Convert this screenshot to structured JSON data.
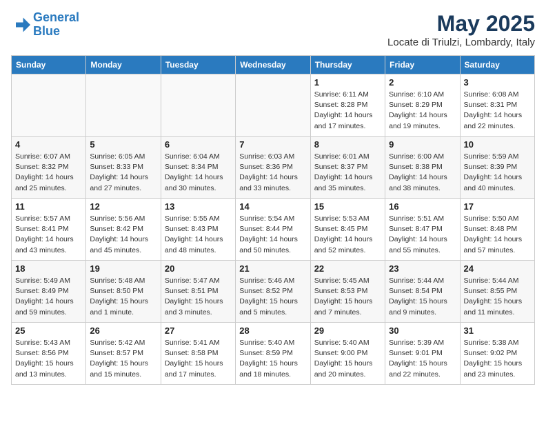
{
  "header": {
    "logo_line1": "General",
    "logo_line2": "Blue",
    "month_year": "May 2025",
    "location": "Locate di Triulzi, Lombardy, Italy"
  },
  "days_of_week": [
    "Sunday",
    "Monday",
    "Tuesday",
    "Wednesday",
    "Thursday",
    "Friday",
    "Saturday"
  ],
  "weeks": [
    [
      {
        "day": "",
        "info": "",
        "empty": true
      },
      {
        "day": "",
        "info": "",
        "empty": true
      },
      {
        "day": "",
        "info": "",
        "empty": true
      },
      {
        "day": "",
        "info": "",
        "empty": true
      },
      {
        "day": "1",
        "info": "Sunrise: 6:11 AM\nSunset: 8:28 PM\nDaylight: 14 hours\nand 17 minutes."
      },
      {
        "day": "2",
        "info": "Sunrise: 6:10 AM\nSunset: 8:29 PM\nDaylight: 14 hours\nand 19 minutes."
      },
      {
        "day": "3",
        "info": "Sunrise: 6:08 AM\nSunset: 8:31 PM\nDaylight: 14 hours\nand 22 minutes."
      }
    ],
    [
      {
        "day": "4",
        "info": "Sunrise: 6:07 AM\nSunset: 8:32 PM\nDaylight: 14 hours\nand 25 minutes."
      },
      {
        "day": "5",
        "info": "Sunrise: 6:05 AM\nSunset: 8:33 PM\nDaylight: 14 hours\nand 27 minutes."
      },
      {
        "day": "6",
        "info": "Sunrise: 6:04 AM\nSunset: 8:34 PM\nDaylight: 14 hours\nand 30 minutes."
      },
      {
        "day": "7",
        "info": "Sunrise: 6:03 AM\nSunset: 8:36 PM\nDaylight: 14 hours\nand 33 minutes."
      },
      {
        "day": "8",
        "info": "Sunrise: 6:01 AM\nSunset: 8:37 PM\nDaylight: 14 hours\nand 35 minutes."
      },
      {
        "day": "9",
        "info": "Sunrise: 6:00 AM\nSunset: 8:38 PM\nDaylight: 14 hours\nand 38 minutes."
      },
      {
        "day": "10",
        "info": "Sunrise: 5:59 AM\nSunset: 8:39 PM\nDaylight: 14 hours\nand 40 minutes."
      }
    ],
    [
      {
        "day": "11",
        "info": "Sunrise: 5:57 AM\nSunset: 8:41 PM\nDaylight: 14 hours\nand 43 minutes."
      },
      {
        "day": "12",
        "info": "Sunrise: 5:56 AM\nSunset: 8:42 PM\nDaylight: 14 hours\nand 45 minutes."
      },
      {
        "day": "13",
        "info": "Sunrise: 5:55 AM\nSunset: 8:43 PM\nDaylight: 14 hours\nand 48 minutes."
      },
      {
        "day": "14",
        "info": "Sunrise: 5:54 AM\nSunset: 8:44 PM\nDaylight: 14 hours\nand 50 minutes."
      },
      {
        "day": "15",
        "info": "Sunrise: 5:53 AM\nSunset: 8:45 PM\nDaylight: 14 hours\nand 52 minutes."
      },
      {
        "day": "16",
        "info": "Sunrise: 5:51 AM\nSunset: 8:47 PM\nDaylight: 14 hours\nand 55 minutes."
      },
      {
        "day": "17",
        "info": "Sunrise: 5:50 AM\nSunset: 8:48 PM\nDaylight: 14 hours\nand 57 minutes."
      }
    ],
    [
      {
        "day": "18",
        "info": "Sunrise: 5:49 AM\nSunset: 8:49 PM\nDaylight: 14 hours\nand 59 minutes."
      },
      {
        "day": "19",
        "info": "Sunrise: 5:48 AM\nSunset: 8:50 PM\nDaylight: 15 hours\nand 1 minute."
      },
      {
        "day": "20",
        "info": "Sunrise: 5:47 AM\nSunset: 8:51 PM\nDaylight: 15 hours\nand 3 minutes."
      },
      {
        "day": "21",
        "info": "Sunrise: 5:46 AM\nSunset: 8:52 PM\nDaylight: 15 hours\nand 5 minutes."
      },
      {
        "day": "22",
        "info": "Sunrise: 5:45 AM\nSunset: 8:53 PM\nDaylight: 15 hours\nand 7 minutes."
      },
      {
        "day": "23",
        "info": "Sunrise: 5:44 AM\nSunset: 8:54 PM\nDaylight: 15 hours\nand 9 minutes."
      },
      {
        "day": "24",
        "info": "Sunrise: 5:44 AM\nSunset: 8:55 PM\nDaylight: 15 hours\nand 11 minutes."
      }
    ],
    [
      {
        "day": "25",
        "info": "Sunrise: 5:43 AM\nSunset: 8:56 PM\nDaylight: 15 hours\nand 13 minutes."
      },
      {
        "day": "26",
        "info": "Sunrise: 5:42 AM\nSunset: 8:57 PM\nDaylight: 15 hours\nand 15 minutes."
      },
      {
        "day": "27",
        "info": "Sunrise: 5:41 AM\nSunset: 8:58 PM\nDaylight: 15 hours\nand 17 minutes."
      },
      {
        "day": "28",
        "info": "Sunrise: 5:40 AM\nSunset: 8:59 PM\nDaylight: 15 hours\nand 18 minutes."
      },
      {
        "day": "29",
        "info": "Sunrise: 5:40 AM\nSunset: 9:00 PM\nDaylight: 15 hours\nand 20 minutes."
      },
      {
        "day": "30",
        "info": "Sunrise: 5:39 AM\nSunset: 9:01 PM\nDaylight: 15 hours\nand 22 minutes."
      },
      {
        "day": "31",
        "info": "Sunrise: 5:38 AM\nSunset: 9:02 PM\nDaylight: 15 hours\nand 23 minutes."
      }
    ]
  ]
}
